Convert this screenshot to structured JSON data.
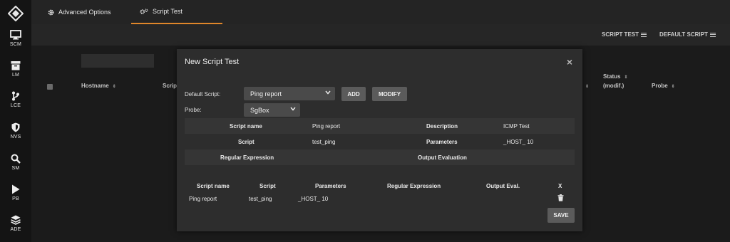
{
  "sidebar": {
    "items": [
      {
        "label": "SCM",
        "icon": "monitor-icon"
      },
      {
        "label": "LM",
        "icon": "archive-icon"
      },
      {
        "label": "LCE",
        "icon": "branch-icon"
      },
      {
        "label": "NVS",
        "icon": "shield-icon"
      },
      {
        "label": "SM",
        "icon": "search-icon"
      },
      {
        "label": "PB",
        "icon": "play-icon"
      },
      {
        "label": "ADE",
        "icon": "layers-icon"
      }
    ]
  },
  "tabs": [
    {
      "label": "Advanced Options",
      "icon": "gear-icon",
      "active": false
    },
    {
      "label": "Script Test",
      "icon": "gears-icon",
      "active": true
    }
  ],
  "subbar": {
    "script_test": "SCRIPT TEST",
    "default_script": "DEFAULT SCRIPT"
  },
  "background_table": {
    "headers": [
      "Hostname",
      "Scrip",
      "Status",
      "(modif.)",
      "Probe"
    ]
  },
  "modal": {
    "title": "New Script Test",
    "close": "×",
    "default_script_label": "Default Script:",
    "default_script_value": "Ping report",
    "probe_label": "Probe:",
    "probe_value": "SgBox",
    "add_button": "ADD",
    "modify_button": "MODIFY",
    "details": {
      "script_name_label": "Script name",
      "script_name_value": "Ping report",
      "description_label": "Description",
      "description_value": "ICMP Test",
      "script_label": "Script",
      "script_value": "test_ping",
      "parameters_label": "Parameters",
      "parameters_value": "_HOST_ 10",
      "regex_label": "Regular Expression",
      "output_eval_label": "Output Evaluation"
    },
    "results": {
      "headers": [
        "Script name",
        "Script",
        "Parameters",
        "Regular Expression",
        "Output Eval.",
        "X"
      ],
      "row": {
        "script_name": "Ping report",
        "script": "test_ping",
        "parameters": "_HOST_ 10",
        "regex": "",
        "output_eval": ""
      }
    },
    "save_button": "SAVE"
  },
  "colors": {
    "accent": "#e0862a",
    "sidebar_bg": "#141414",
    "modal_bg": "#2d2d2d"
  }
}
